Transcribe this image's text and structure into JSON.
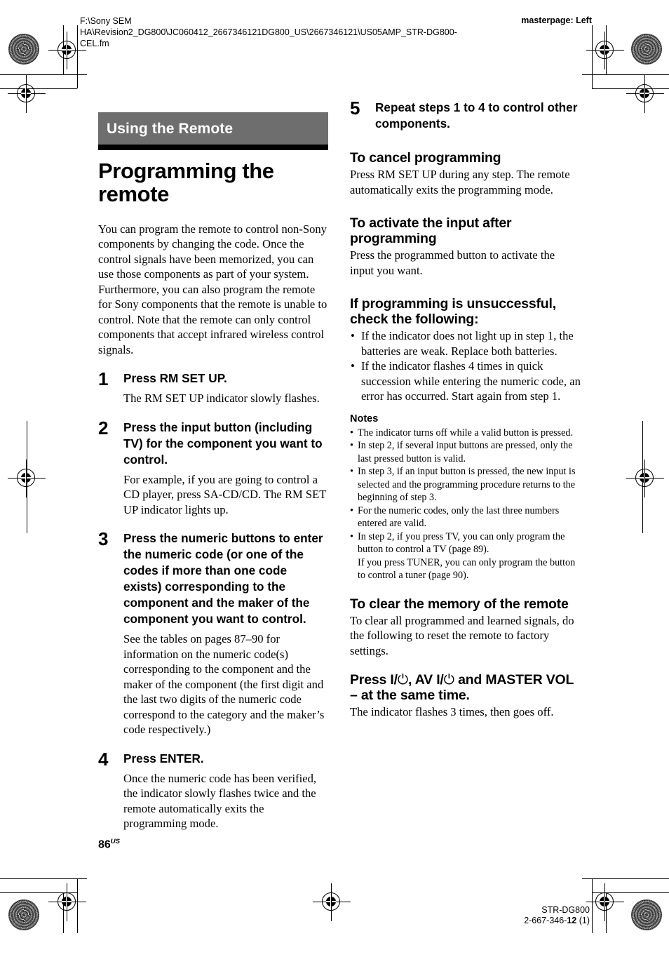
{
  "running_head": {
    "file_path": "F:\\Sony SEM\nHA\\Revision2_DG800\\JC060412_2667346121DG800_US\\2667346121\\US05AMP_STR-DG800-\nCEL.fm",
    "masterpage": "masterpage: Left"
  },
  "left_column": {
    "banner": "Using the Remote",
    "chapter_title": "Programming the remote",
    "intro": "You can program the remote to control non-Sony components by changing the code. Once the control signals have been memorized, you can use those components as part of your system.\nFurthermore, you can also program the remote for Sony components that the remote is unable to control. Note that the remote can only control components that accept infrared wireless control signals.",
    "steps": [
      {
        "num": "1",
        "head": "Press RM SET UP.",
        "sub": "The RM SET UP indicator slowly flashes."
      },
      {
        "num": "2",
        "head": "Press the input button (including TV) for the component you want to control.",
        "sub": "For example, if you are going to control a CD player, press SA-CD/CD. The RM SET UP indicator lights up."
      },
      {
        "num": "3",
        "head": "Press the numeric buttons to enter the numeric code (or one of the codes if more than one code exists) corresponding to the component and the maker of the component you want to control.",
        "sub": "See the tables on pages 87–90 for information on the numeric code(s) corresponding to the component and the maker of the component (the first digit and the last two digits of the numeric code correspond to the category and the maker’s code respectively.)"
      },
      {
        "num": "4",
        "head": "Press ENTER.",
        "sub": "Once the numeric code has been verified, the indicator slowly flashes twice and the remote automatically exits the programming mode."
      }
    ]
  },
  "right_column": {
    "step5": {
      "num": "5",
      "head": "Repeat steps 1 to 4 to control other components."
    },
    "cancel": {
      "heading": "To cancel programming",
      "body": "Press RM SET UP during any step. The remote automatically exits the programming mode."
    },
    "activate": {
      "heading": "To activate the input after programming",
      "body": "Press the programmed button to activate the input you want."
    },
    "unsuccessful": {
      "heading": "If programming is unsuccessful, check the following:",
      "bullets": [
        "If the indicator does not light up in step 1, the batteries are weak. Replace both batteries.",
        "If the indicator flashes 4 times in quick succession while entering the numeric code, an error has occurred. Start again from step 1."
      ]
    },
    "notes": {
      "heading": "Notes",
      "items": [
        {
          "text": "The indicator turns off while a valid button is pressed.",
          "cont": ""
        },
        {
          "text": "In step 2, if several input buttons are pressed, only the last pressed button is valid.",
          "cont": ""
        },
        {
          "text": "In step 3, if an input button is pressed, the new input is selected and the programming procedure returns to the beginning of step 3.",
          "cont": ""
        },
        {
          "text": "For the numeric codes, only the last three numbers entered are valid.",
          "cont": ""
        },
        {
          "text": "In step 2, if you press TV, you can only program the button to control a TV (page 89).",
          "cont": "If you press TUNER, you can only program the button to control a tuner (page 90)."
        }
      ]
    },
    "clear_memory": {
      "heading": "To clear the memory of the remote",
      "body": "To clear all programmed and learned signals, do the following to reset the remote to factory settings.",
      "action_heading_pre": "Press I/",
      "action_heading_mid": ", AV I/",
      "action_heading_post": " and MASTER VOL – at the same time.",
      "power_symbol": "⏻",
      "action_body": "The indicator flashes 3 times, then goes off."
    }
  },
  "footer": {
    "page_number": "86",
    "page_suffix": "US",
    "model": "STR-DG800",
    "part_pre": "2-667-346-",
    "part_bold": "12",
    "part_post": " (1)"
  }
}
